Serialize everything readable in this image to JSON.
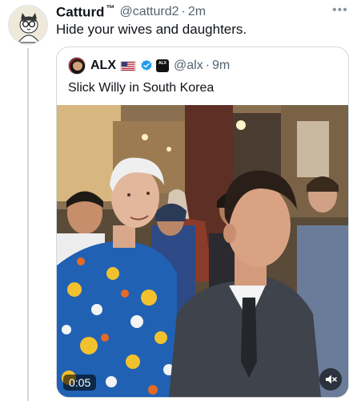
{
  "tweet": {
    "author_name": "Catturd",
    "author_tm": "™",
    "handle": "@catturd2",
    "separator": "·",
    "time": "2m",
    "text": "Hide your wives and daughters.",
    "more_glyph": "•••"
  },
  "quote": {
    "author_name": "ALX",
    "handle": "@alx",
    "separator": "·",
    "time": "9m",
    "text": "Slick Willy in South Korea",
    "badge_text": "ALX"
  },
  "video": {
    "duration": "0:05",
    "muted": true
  },
  "colors": {
    "muted_text": "#536471",
    "verified_blue": "#1d9bf0",
    "border": "#cfd9de"
  },
  "icons": [
    "more-icon",
    "us-flag-icon",
    "verified-badge-icon",
    "affiliate-badge-icon",
    "mute-icon"
  ]
}
